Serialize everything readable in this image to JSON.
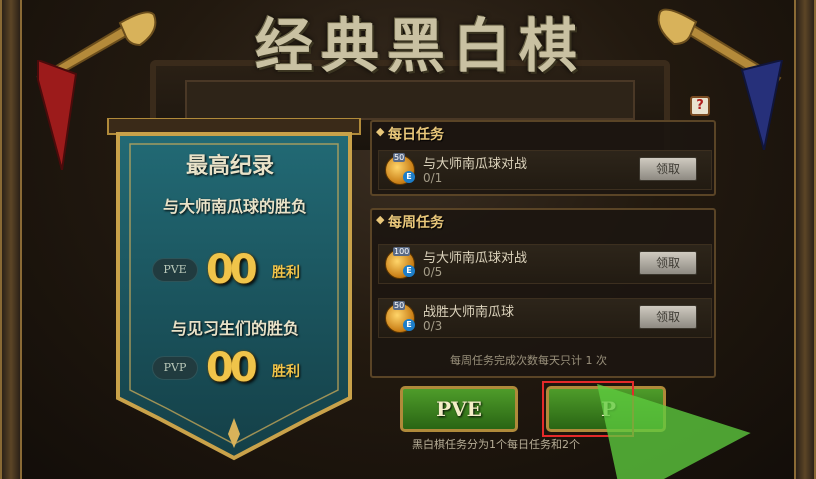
{
  "title": "经典黑白棋",
  "help_icon": "help-book-icon",
  "record": {
    "heading": "最高纪录",
    "pve_label": "与大师南瓜球的胜负",
    "pve_tag": "PVE",
    "pve_value": "00",
    "pve_unit": "胜利",
    "pvp_label": "与见习生们的胜负",
    "pvp_tag": "PVP",
    "pvp_value": "00",
    "pvp_unit": "胜利"
  },
  "daily": {
    "heading": "每日任务",
    "tasks": [
      {
        "reward": "50",
        "name": "与大师南瓜球对战",
        "progress": "0/1",
        "button": "领取"
      }
    ]
  },
  "weekly": {
    "heading": "每周任务",
    "tasks": [
      {
        "reward": "100",
        "name": "与大师南瓜球对战",
        "progress": "0/5",
        "button": "领取"
      },
      {
        "reward": "50",
        "name": "战胜大师南瓜球",
        "progress": "0/3",
        "button": "领取"
      }
    ],
    "note": "每周任务完成次数每天只计 1 次"
  },
  "buttons": {
    "pve": "PVE",
    "pvp": "P"
  },
  "footer": "黑白棋任务分为1个每日任务和2个",
  "colors": {
    "gold": "#f0c44a",
    "button_green": "#4e9c2a",
    "banner_teal": "#1e5c66",
    "highlight_red": "#e42a2a"
  }
}
